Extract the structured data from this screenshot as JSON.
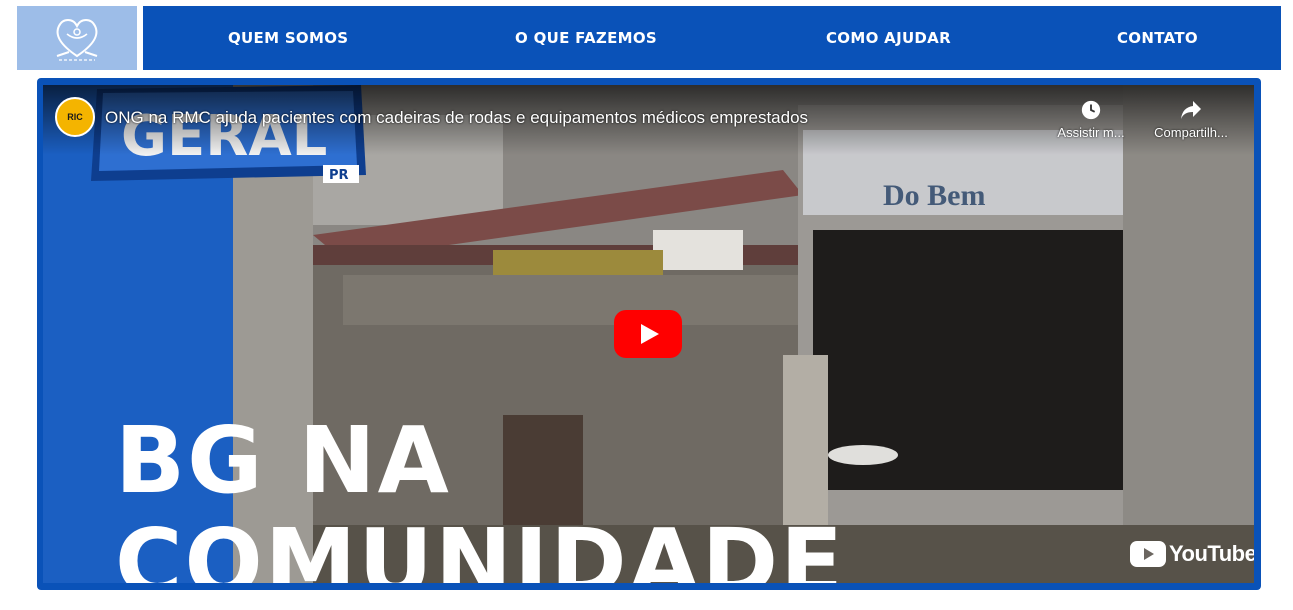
{
  "logo": {
    "icon": "heart-hands-logo-icon"
  },
  "nav": {
    "items": [
      {
        "label": "QUEM SOMOS"
      },
      {
        "label": "O QUE FAZEMOS"
      },
      {
        "label": "COMO AJUDAR"
      },
      {
        "label": "CONTATO"
      }
    ]
  },
  "video": {
    "channel_badge": "RIC",
    "title": "ONG na RMC ajuda pacientes com cadeiras de rodas e equipamentos médicos emprestados",
    "watch_later_label": "Assistir m...",
    "share_label": "Compartilh...",
    "play_icon": "play-icon",
    "show_logo_text": "GERAL",
    "show_logo_region": "PR",
    "store_sign": "Do Bem",
    "overlay_line1": "BG NA",
    "overlay_line2": "COMUNIDADE",
    "youtube_logo": "YouTube"
  },
  "colors": {
    "nav_bg": "#0a52b8",
    "logo_bg": "#9dbde8",
    "play_red": "#ff0000"
  }
}
